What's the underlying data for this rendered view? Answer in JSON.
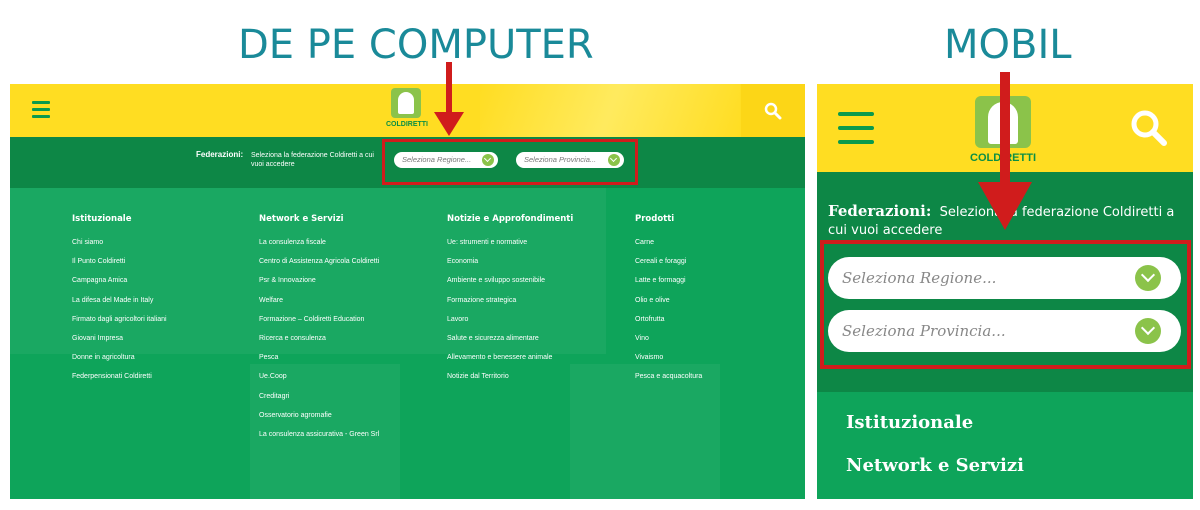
{
  "captions": {
    "desktop": "DE PE COMPUTER",
    "mobile": "MOBIL"
  },
  "colors": {
    "header_yellow": "#ffdd22",
    "green_dark": "#0d8746",
    "green_main": "#0ea45a",
    "accent_lime": "#8bc34a",
    "highlight_red": "#d01c1c",
    "caption_teal": "#1a8a99"
  },
  "desktop": {
    "logo_text": "COLDIRETTI",
    "federazioni_label": "Federazioni:",
    "federazioni_text": "Seleziona la federazione Coldiretti a cui vuoi accedere",
    "select_regione_placeholder": "Seleziona Regione...",
    "select_provincia_placeholder": "Seleziona Provincia...",
    "menu": [
      {
        "heading": "Istituzionale",
        "items": [
          "Chi siamo",
          "Il Punto Coldiretti",
          "Campagna Amica",
          "La difesa del Made in Italy",
          "Firmato dagli agricoltori italiani",
          "Giovani Impresa",
          "Donne in agricoltura",
          "Federpensionati Coldiretti"
        ]
      },
      {
        "heading": "Network e Servizi",
        "items": [
          "La consulenza fiscale",
          "Centro di Assistenza Agricola Coldiretti",
          "Psr & Innovazione",
          "Welfare",
          "Formazione – Coldiretti Education",
          "Ricerca e consulenza",
          "Pesca",
          "Ue.Coop",
          "Creditagri",
          "Osservatorio agromafie",
          "La consulenza assicurativa - Green Srl"
        ]
      },
      {
        "heading": "Notizie e Approfondimenti",
        "items": [
          "Ue: strumenti e normative",
          "Economia",
          "Ambiente e sviluppo sostenibile",
          "Formazione strategica",
          "Lavoro",
          "Salute e sicurezza alimentare",
          "Allevamento e benessere animale",
          "Notizie dal Territorio"
        ]
      },
      {
        "heading": "Prodotti",
        "items": [
          "Carne",
          "Cereali e foraggi",
          "Latte e formaggi",
          "Olio e olive",
          "Ortofrutta",
          "Vino",
          "Vivaismo",
          "Pesca e acquacoltura"
        ]
      }
    ]
  },
  "mobile": {
    "logo_text": "COLDIRETTI",
    "federazioni_label": "Federazioni:",
    "federazioni_text": "Seleziona la federazione Coldiretti a cui vuoi accedere",
    "select_regione_placeholder": "Seleziona Regione...",
    "select_provincia_placeholder": "Seleziona Provincia...",
    "menu": [
      "Istituzionale",
      "Network e Servizi"
    ]
  }
}
